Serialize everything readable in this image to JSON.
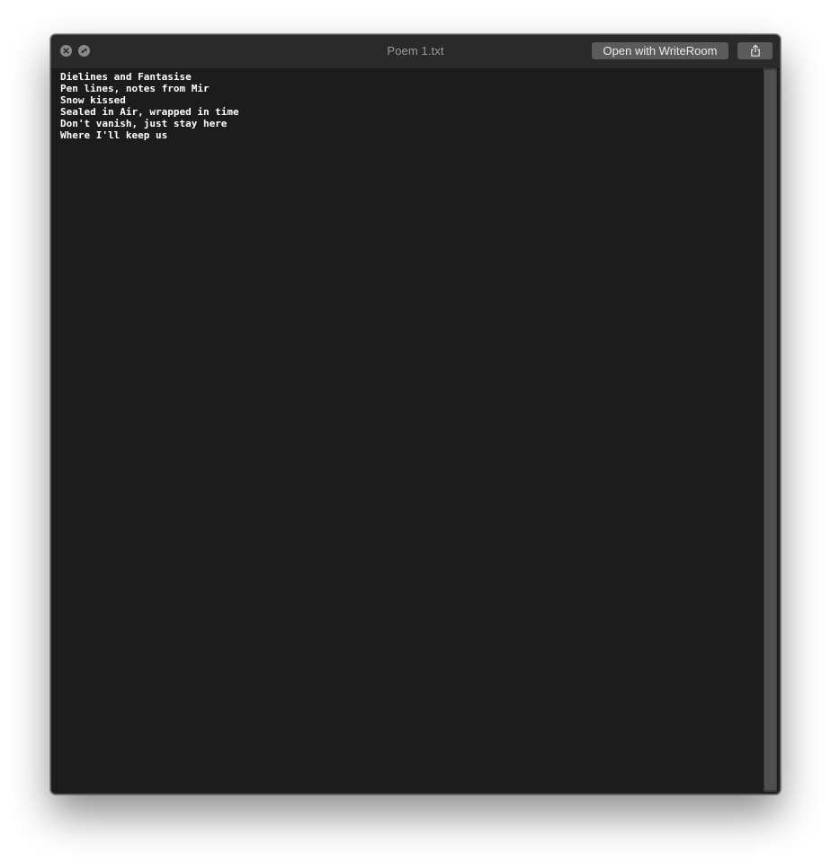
{
  "window": {
    "title": "Poem 1.txt"
  },
  "toolbar": {
    "open_with_label": "Open with WriteRoom",
    "share_icon": "share-icon",
    "close_icon": "close-icon",
    "fullscreen_icon": "fullscreen-icon"
  },
  "document": {
    "lines": [
      "Dielines and Fantasise",
      "Pen lines, notes from Mir",
      "Snow kissed",
      "Sealed in Air, wrapped in time",
      "Don't vanish, just stay here",
      "Where I'll keep us"
    ]
  },
  "colors": {
    "window_bg": "#1e1e1e",
    "titlebar_bg": "#2a2a2a",
    "button_bg": "#5b5b5b",
    "text": "#ffffff",
    "title_text": "#9a9a9a"
  }
}
